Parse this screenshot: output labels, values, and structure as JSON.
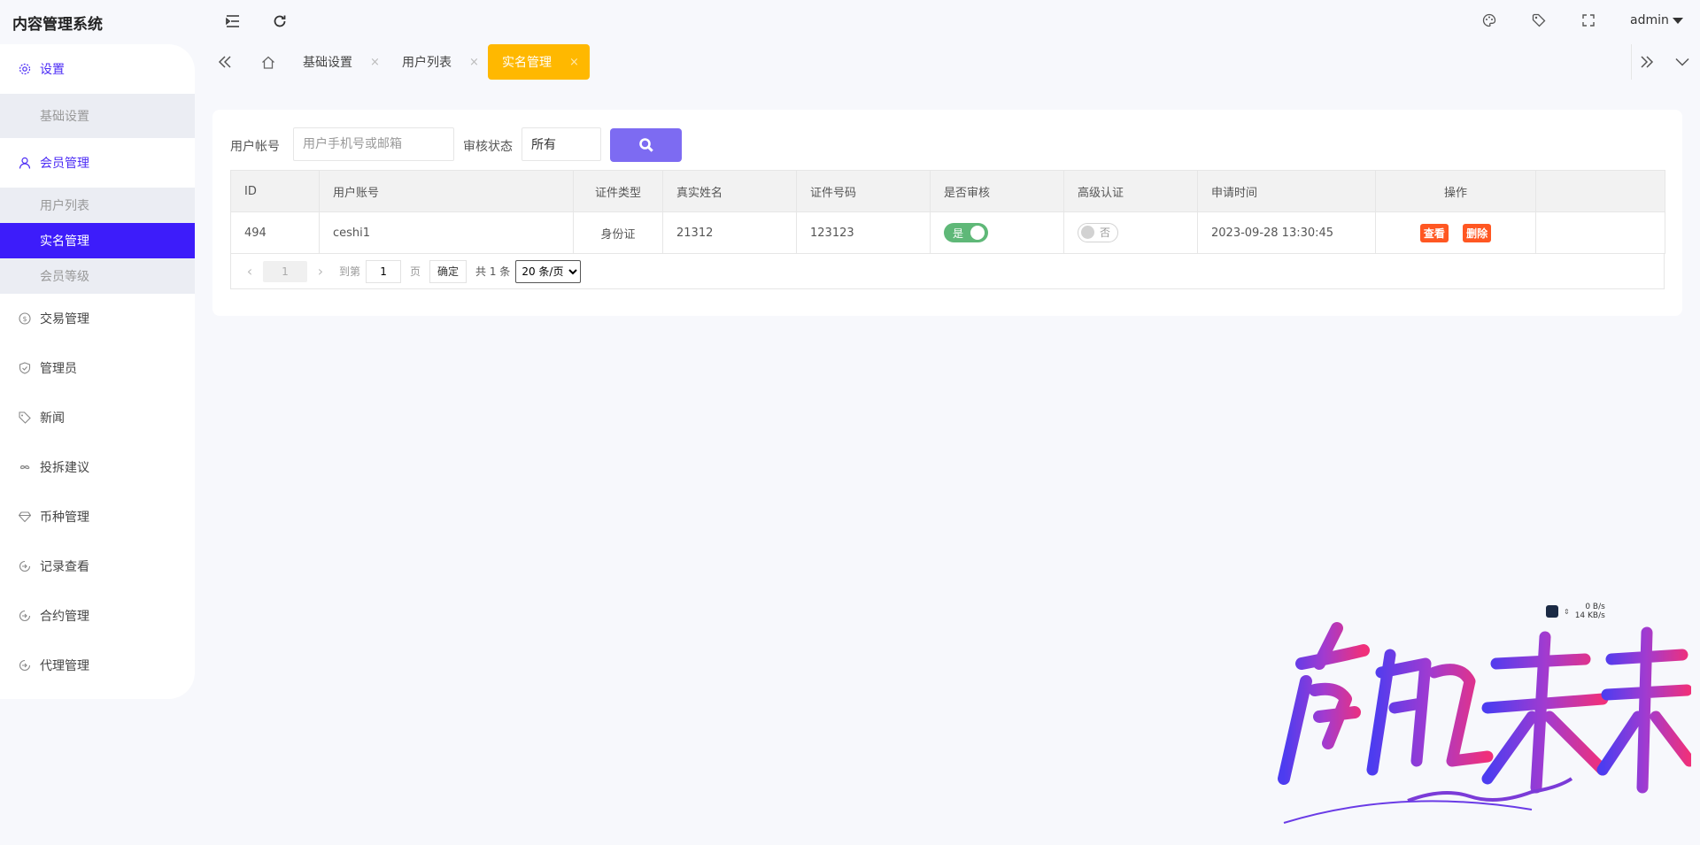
{
  "app": {
    "title": "内容管理系统"
  },
  "header": {
    "user": "admin"
  },
  "sidebar": {
    "items": [
      {
        "label": "设置",
        "icon": "gear-icon"
      },
      {
        "label": "会员管理",
        "icon": "user-icon"
      },
      {
        "label": "交易管理",
        "icon": "dollar-icon"
      },
      {
        "label": "管理员",
        "icon": "shield-icon"
      },
      {
        "label": "新闻",
        "icon": "tag-icon"
      },
      {
        "label": "投拆建议",
        "icon": "infinity-icon"
      },
      {
        "label": "币种管理",
        "icon": "diamond-icon"
      },
      {
        "label": "记录查看",
        "icon": "circle-arrow-icon"
      },
      {
        "label": "合约管理",
        "icon": "circle-arrow-icon"
      },
      {
        "label": "代理管理",
        "icon": "circle-arrow-icon"
      }
    ],
    "settings_sub": [
      "基础设置"
    ],
    "members_sub": [
      "用户列表",
      "实名管理",
      "会员等级"
    ]
  },
  "tabs": [
    {
      "label": "基础设置",
      "close": "×"
    },
    {
      "label": "用户列表",
      "close": "×"
    },
    {
      "label": "实名管理",
      "close": "×"
    }
  ],
  "filters": {
    "account_label": "用户帐号",
    "account_placeholder": "用户手机号或邮箱",
    "status_label": "审核状态",
    "status_value": "所有"
  },
  "table": {
    "columns": [
      "ID",
      "用户账号",
      "证件类型",
      "真实姓名",
      "证件号码",
      "是否审核",
      "高级认证",
      "申请时间",
      "操作",
      ""
    ],
    "rows": [
      {
        "id": "494",
        "account": "ceshi1",
        "doc_type": "身份证",
        "real_name": "21312",
        "doc_number": "123123",
        "reviewed": "是",
        "advanced": "否",
        "applied_at": "2023-09-28 13:30:45",
        "view": "查看",
        "delete": "删除"
      }
    ]
  },
  "pager": {
    "current_page": "1",
    "goto_label": "到第",
    "goto_value": "1",
    "page_unit": "页",
    "confirm": "确定",
    "total": "共 1 条",
    "page_size": "20 条/页"
  },
  "net_speed": {
    "up": "0 B/s",
    "down": "14 KB/s"
  },
  "colors": {
    "accent": "#3d1cfa",
    "tab_active": "#ffb800",
    "switch_on": "#5fb878",
    "danger": "#ff5722",
    "search": "#7d6bf2"
  }
}
